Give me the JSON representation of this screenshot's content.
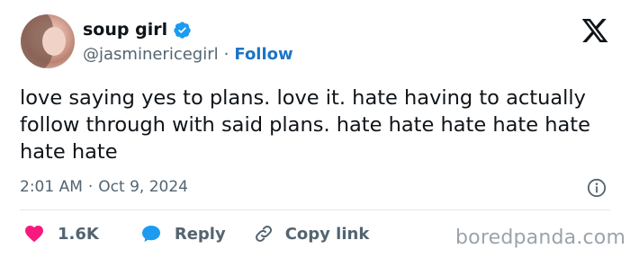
{
  "user": {
    "display_name": "soup girl",
    "handle": "@jasminericegirl",
    "separator": "·",
    "follow_label": "Follow"
  },
  "tweet": {
    "text": "love saying yes to plans. love it. hate having to actually follow through with said plans. hate hate hate hate hate hate hate",
    "time": "2:01 AM",
    "date_separator": "·",
    "date": "Oct 9, 2024"
  },
  "actions": {
    "like_count": "1.6K",
    "reply_label": "Reply",
    "copy_link_label": "Copy link"
  },
  "watermark": "boredpanda.com",
  "icons": {
    "verified": "verified-badge-icon",
    "logo": "x-logo-icon",
    "info": "info-icon",
    "like": "heart-icon",
    "reply": "speech-bubble-icon",
    "link": "link-icon"
  },
  "colors": {
    "accent": "#1d9bf0",
    "follow": "#1d75c4",
    "like": "#f91880",
    "muted": "#536471",
    "text": "#0f1419"
  }
}
